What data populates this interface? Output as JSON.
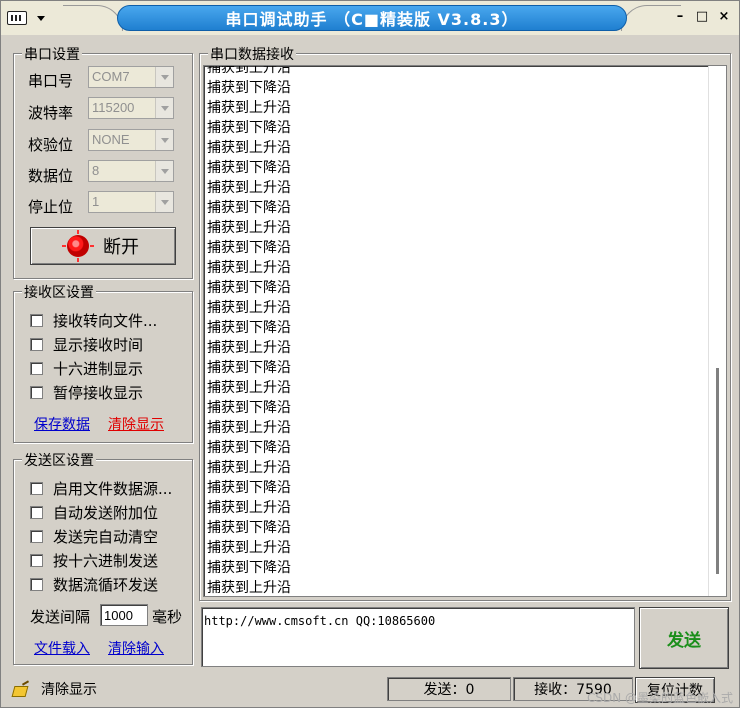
{
  "window": {
    "title": "串口调试助手 （C■精装版 V3.8.3）",
    "controls": {
      "minimize": "–",
      "restore": "□",
      "close": "×"
    }
  },
  "serial_settings": {
    "legend": "串口设置",
    "port": {
      "label": "串口号",
      "value": "COM7"
    },
    "baud": {
      "label": "波特率",
      "value": "115200"
    },
    "parity": {
      "label": "校验位",
      "value": "NONE"
    },
    "databits": {
      "label": "数据位",
      "value": "8"
    },
    "stopbits": {
      "label": "停止位",
      "value": "1"
    },
    "toggle_label": "断开"
  },
  "receive_settings": {
    "legend": "接收区设置",
    "options": [
      "接收转向文件...",
      "显示接收时间",
      "十六进制显示",
      "暂停接收显示"
    ],
    "save_link": "保存数据",
    "clear_link": "清除显示"
  },
  "send_settings": {
    "legend": "发送区设置",
    "options": [
      "启用文件数据源...",
      "自动发送附加位",
      "发送完自动清空",
      "按十六进制发送",
      "数据流循环发送"
    ],
    "interval_label": "发送间隔",
    "interval_value": "1000",
    "interval_unit": "毫秒",
    "load_link": "文件载入",
    "clear_link": "清除输入"
  },
  "receive_area": {
    "legend": "串口数据接收",
    "lines": [
      "捕获到上升沿",
      "捕获到下降沿",
      "捕获到上升沿",
      "捕获到下降沿",
      "捕获到上升沿",
      "捕获到下降沿",
      "捕获到上升沿",
      "捕获到下降沿",
      "捕获到上升沿",
      "捕获到下降沿",
      "捕获到上升沿",
      "捕获到下降沿",
      "捕获到上升沿",
      "捕获到下降沿",
      "捕获到上升沿",
      "捕获到下降沿",
      "捕获到上升沿",
      "捕获到下降沿",
      "捕获到上升沿",
      "捕获到下降沿",
      "捕获到上升沿",
      "捕获到下降沿",
      "捕获到上升沿",
      "捕获到下降沿",
      "捕获到上升沿",
      "捕获到下降沿",
      "捕获到上升沿",
      "捕获到下降沿",
      "捕获到上升沿"
    ]
  },
  "send_area": {
    "text": "http://www.cmsoft.cn QQ:10865600",
    "send_label": "发送"
  },
  "status_bar": {
    "clear_label": "清除显示",
    "sent": "发送：0",
    "received": "接收：7590",
    "reset_label": "复位计数",
    "watermark": "CSDN @墨染的蓝色嵌入式"
  },
  "colors": {
    "title_bar": "#1f7fd0",
    "send_button_text": "#1b8f1b",
    "clear_link": "#e00000",
    "link": "#0000cc",
    "led": "#ff1a1a"
  }
}
